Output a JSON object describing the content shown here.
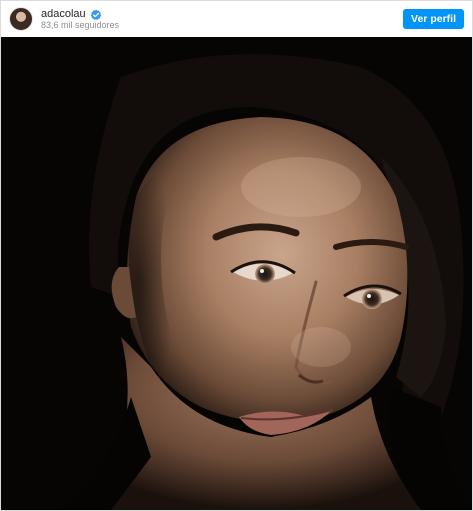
{
  "post_header": {
    "username": "adacolau",
    "followers": "83,6 mil seguidores",
    "view_profile_label": "Ver perfil",
    "verified_icon": "verified-badge-icon",
    "accent_color": "#0095f6"
  },
  "photo": {
    "description_icon": "portrait-photo"
  }
}
